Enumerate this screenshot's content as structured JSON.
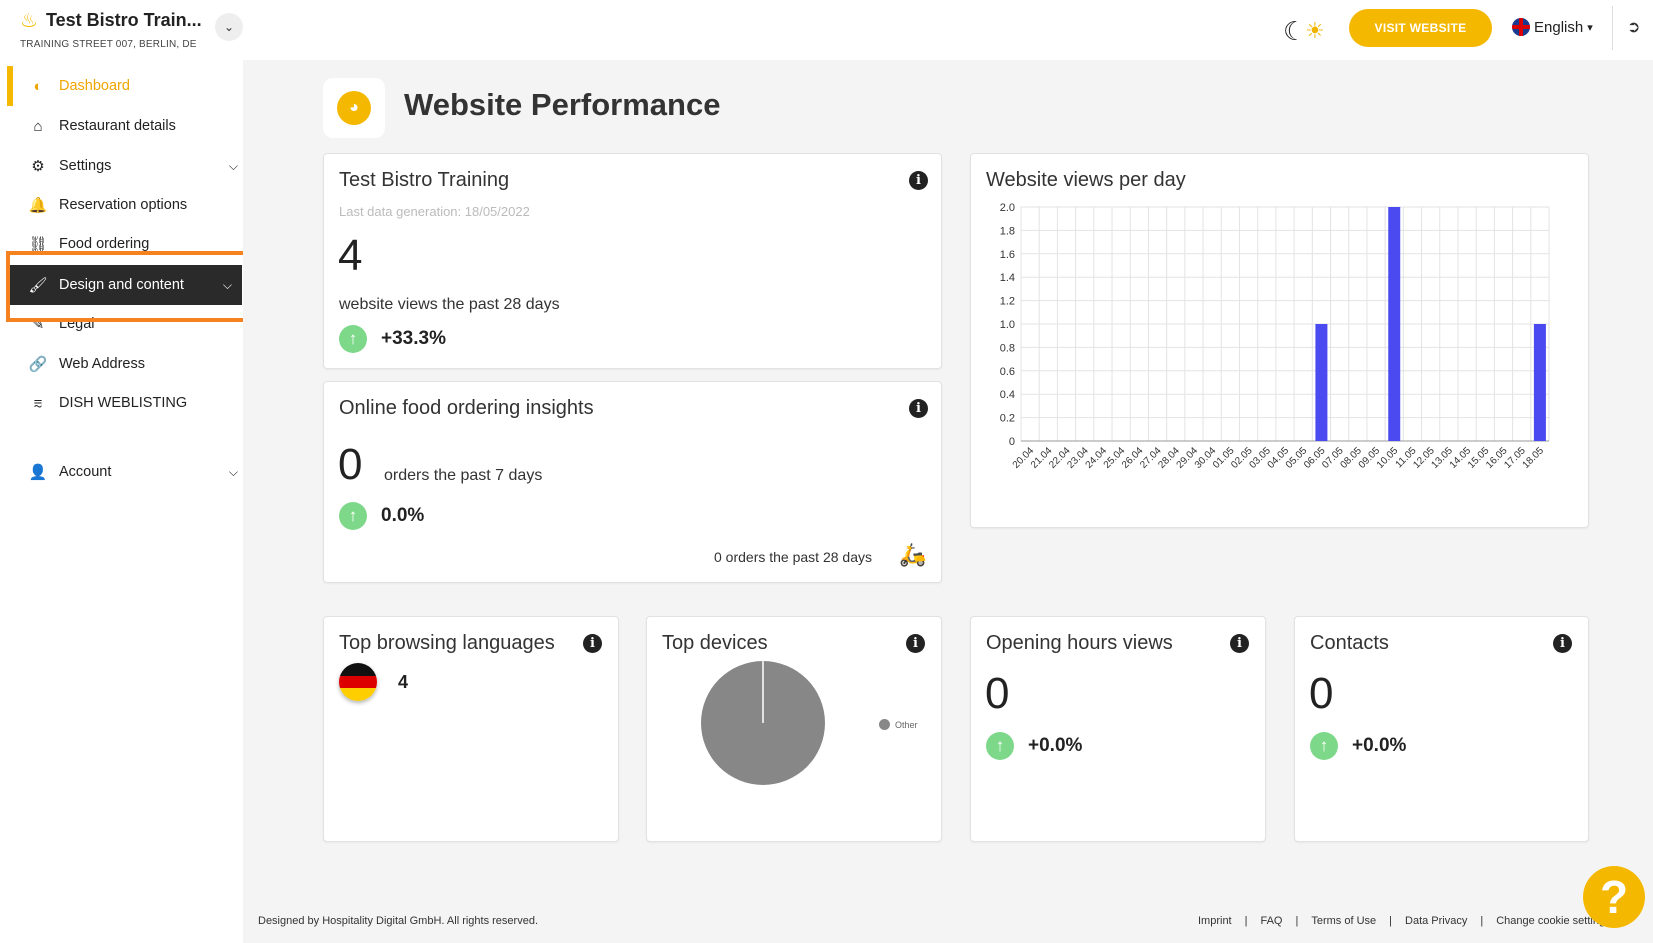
{
  "header": {
    "restaurant_name": "Test Bistro Train...",
    "address": "TRAINING STREET 007, BERLIN, DE",
    "visit_website": "VISIT WEBSITE",
    "language": "English"
  },
  "sidebar": {
    "items": [
      {
        "label": "Dashboard",
        "icon": "gauge-icon"
      },
      {
        "label": "Restaurant details",
        "icon": "home-icon"
      },
      {
        "label": "Settings",
        "icon": "gear-icon"
      },
      {
        "label": "Reservation options",
        "icon": "bell-icon"
      },
      {
        "label": "Food ordering",
        "icon": "scooter-icon"
      },
      {
        "label": "Design and content",
        "icon": "brush-icon"
      },
      {
        "label": "Legal",
        "icon": "document-icon"
      },
      {
        "label": "Web Address",
        "icon": "link-icon"
      },
      {
        "label": "DISH WEBLISTING",
        "icon": "share-icon"
      },
      {
        "label": "Account",
        "icon": "user-icon"
      }
    ]
  },
  "page": {
    "title": "Website Performance"
  },
  "cards": {
    "website": {
      "title": "Test Bistro Training",
      "last_generation": "Last data generation: 18/05/2022",
      "value": "4",
      "caption": "website views the past 28 days",
      "trend": "+33.3%"
    },
    "food": {
      "title": "Online food ordering insights",
      "value": "0",
      "caption": "orders the past 7 days",
      "trend": "0.0%",
      "footer": "0 orders the past 28 days"
    },
    "views_chart": {
      "title": "Website views per day"
    },
    "languages": {
      "title": "Top browsing languages",
      "value": "4"
    },
    "devices": {
      "title": "Top devices",
      "legend": "Other"
    },
    "opening_hours": {
      "title": "Opening hours views",
      "value": "0",
      "trend": "+0.0%"
    },
    "contacts": {
      "title": "Contacts",
      "value": "0",
      "trend": "+0.0%"
    }
  },
  "colors": {
    "accent": "#f5b800",
    "bar": "#4a4af0",
    "pie": "#878787",
    "trend_up": "#7ed88a",
    "highlight": "#f5821f"
  },
  "chart_data": [
    {
      "type": "bar",
      "title": "Website views per day",
      "categories": [
        "20.04",
        "21.04",
        "22.04",
        "23.04",
        "24.04",
        "25.04",
        "26.04",
        "27.04",
        "28.04",
        "29.04",
        "30.04",
        "01.05",
        "02.05",
        "03.05",
        "04.05",
        "05.05",
        "06.05",
        "07.05",
        "08.05",
        "09.05",
        "10.05",
        "11.05",
        "12.05",
        "13.05",
        "14.05",
        "15.05",
        "16.05",
        "17.05",
        "18.05"
      ],
      "values": [
        0,
        0,
        0,
        0,
        0,
        0,
        0,
        0,
        0,
        0,
        0,
        0,
        0,
        0,
        0,
        0,
        1,
        0,
        0,
        0,
        2,
        0,
        0,
        0,
        0,
        0,
        0,
        0,
        1
      ],
      "ylim": [
        0,
        2.0
      ],
      "yticks": [
        "0",
        "0.2",
        "0.4",
        "0.6",
        "0.8",
        "1.0",
        "1.2",
        "1.4",
        "1.6",
        "1.8",
        "2.0"
      ],
      "grid": true
    },
    {
      "type": "pie",
      "title": "Top devices",
      "categories": [
        "Other"
      ],
      "values": [
        100
      ],
      "legend": "right"
    }
  ],
  "footer": {
    "copyright": "Designed by Hospitality Digital GmbH. All rights reserved.",
    "links": [
      "Imprint",
      "FAQ",
      "Terms of Use",
      "Data Privacy",
      "Change cookie settings"
    ]
  }
}
